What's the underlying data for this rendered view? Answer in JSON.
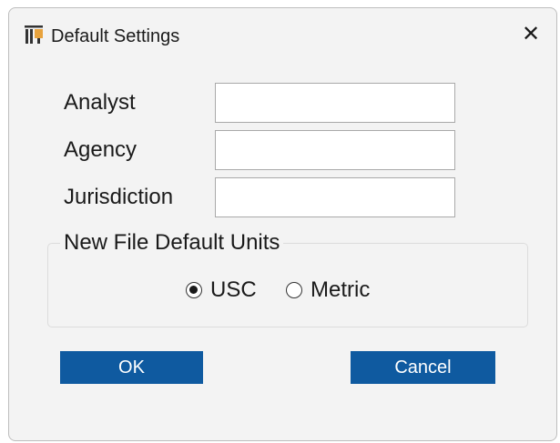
{
  "dialog": {
    "title": "Default Settings",
    "app_icon": "traffic-sign-icon",
    "close_icon": "close-icon",
    "close_glyph": "✕"
  },
  "fields": {
    "analyst": {
      "label": "Analyst",
      "value": ""
    },
    "agency": {
      "label": "Agency",
      "value": ""
    },
    "jurisdiction": {
      "label": "Jurisdiction",
      "value": ""
    }
  },
  "units_group": {
    "legend": "New File Default Units",
    "selected": "USC",
    "options": [
      {
        "label": "USC",
        "checked": true
      },
      {
        "label": "Metric",
        "checked": false
      }
    ]
  },
  "buttons": {
    "ok_label": "OK",
    "cancel_label": "Cancel"
  },
  "colors": {
    "button_background": "#0f5aa0",
    "button_text": "#ffffff",
    "window_background": "#f3f3f3",
    "icon_orange": "#e8a33d",
    "icon_dark": "#333333"
  }
}
